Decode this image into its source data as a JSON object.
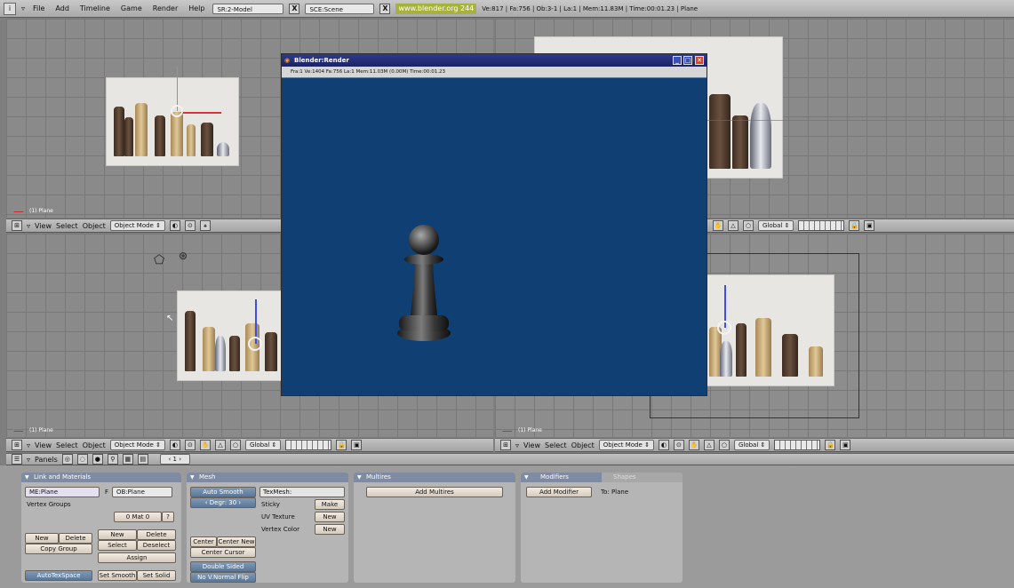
{
  "topbar": {
    "menus": [
      "File",
      "Add",
      "Timeline",
      "Game",
      "Render",
      "Help"
    ],
    "screen_field": "SR:2-Model",
    "scene_field": "SCE:Scene",
    "url": "www.blender.org 244",
    "stats": "Ve:817 | Fa:756 | Ob:3-1 | La:1  | Mem:11.83M  | Time:00:01.23 | Plane"
  },
  "viewports": {
    "plane_label": "(1) Plane",
    "header": {
      "view": "View",
      "select": "Select",
      "object": "Object",
      "mode": "Object Mode",
      "orientation": "Global"
    }
  },
  "render_window": {
    "title": "Blender:Render",
    "info": "Fra:1  Ve:1404 Fa:756 La:1 Mem:11.03M (0.00M) Time:00:01.23"
  },
  "buttons_header": {
    "panels": "Panels",
    "frame": "1"
  },
  "link_materials": {
    "title": "Link and Materials",
    "me_field": "ME:Plane",
    "f_label": "F",
    "ob_field": "OB:Plane",
    "vertex_groups": "Vertex Groups",
    "mat_field": "0 Mat 0",
    "question": "?",
    "new": "New",
    "delete": "Delete",
    "copy_group": "Copy Group",
    "select": "Select",
    "deselect": "Deselect",
    "assign": "Assign",
    "autotexspace": "AutoTexSpace",
    "set_smooth": "Set Smooth",
    "set_solid": "Set Solid"
  },
  "mesh": {
    "title": "Mesh",
    "auto_smooth": "Auto Smooth",
    "degr": "Degr: 30",
    "texmesh": "TexMesh:",
    "sticky": "Sticky",
    "make": "Make",
    "uv_texture": "UV Texture",
    "vertex_color": "Vertex Color",
    "new": "New",
    "center": "Center",
    "center_new": "Center New",
    "center_cursor": "Center Cursor",
    "double_sided": "Double Sided",
    "no_vnormal_flip": "No V.Normal Flip"
  },
  "multires": {
    "title": "Multires",
    "add_multires": "Add Multires"
  },
  "modifiers": {
    "tab_modifiers": "Modifiers",
    "tab_shapes": "Shapes",
    "add_modifier": "Add Modifier",
    "to_label": "To: Plane"
  }
}
